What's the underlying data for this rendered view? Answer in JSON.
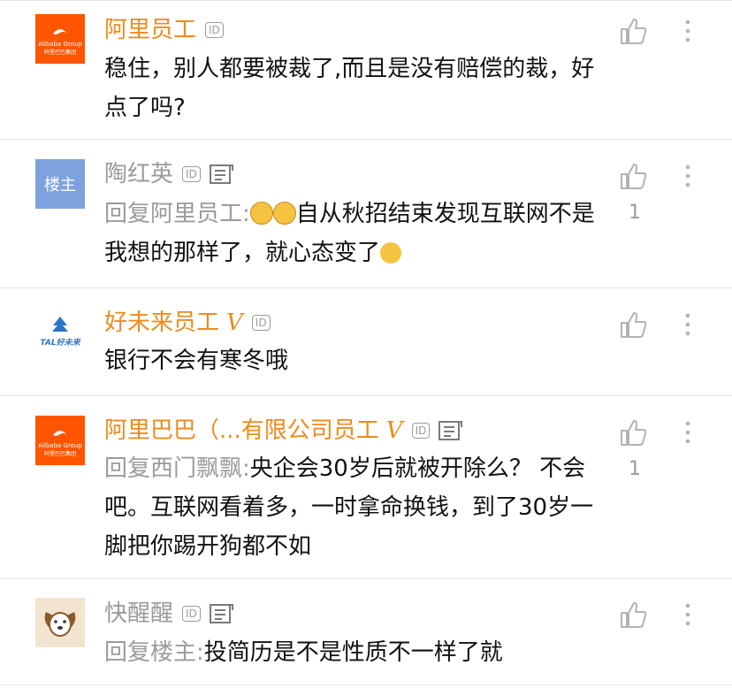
{
  "comments": [
    {
      "name": "阿里员工",
      "id_badge": "ID",
      "body": "稳住，别人都要被裁了,而且是没有赔偿的裁，好点了吗?",
      "likes": "",
      "avatar": "alibaba-logo"
    },
    {
      "name": "陶红英",
      "id_badge": "ID",
      "avatar_label": "楼主",
      "reply_prefix": "回复阿里员工:",
      "body_after_emoji": "自从秋招结束发现互联网不是我想的那样了，就心态变了",
      "likes": "1"
    },
    {
      "name": "好未来员工",
      "v": "V",
      "id_badge": "ID",
      "body": "银行不会有寒冬哦",
      "likes": "",
      "avatar": "tal-logo"
    },
    {
      "name": "阿里巴巴（...有限公司员工",
      "v": "V",
      "id_badge": "ID",
      "reply_prefix": "回复西门飘飘:",
      "body": "央企会30岁后就被开除么？ 不会吧。互联网看着多，一时拿命换钱，到了30岁一脚把你踢开狗都不如",
      "likes": "1",
      "avatar": "alibaba-logo"
    },
    {
      "name": "快醒醒",
      "id_badge": "ID",
      "reply_prefix": "回复楼主:",
      "body": "投简历是不是性质不一样了就",
      "likes": "",
      "avatar": "dog-avatar"
    }
  ],
  "logos": {
    "alibaba_text": "Alibaba Group",
    "alibaba_cn": "阿里巴巴集团",
    "tal_text": "TAL好未来"
  },
  "colors": {
    "orange_name": "#f08a1c",
    "gray_text": "#9b9b9b",
    "alibaba_bg": "#ff5500",
    "host_avatar_bg": "#7da2de"
  }
}
